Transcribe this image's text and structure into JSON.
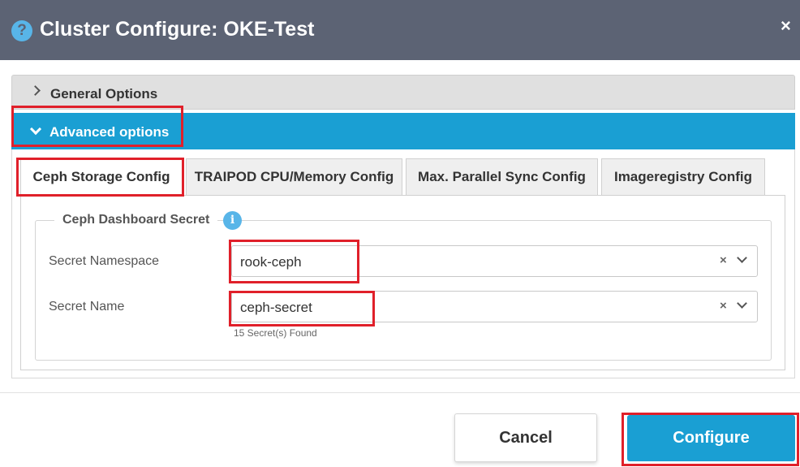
{
  "dialog": {
    "title": "Cluster Configure: OKE-Test",
    "help_glyph": "?",
    "close_glyph": "×"
  },
  "accordion": {
    "general_label": "General Options",
    "advanced_label": "Advanced options"
  },
  "tabs": [
    {
      "label": "Ceph Storage Config",
      "active": true
    },
    {
      "label": "TRAIPOD CPU/Memory Config",
      "active": false
    },
    {
      "label": "Max. Parallel Sync Config",
      "active": false
    },
    {
      "label": "Imageregistry Config",
      "active": false
    }
  ],
  "section": {
    "legend": "Ceph Dashboard Secret",
    "info_glyph": "i"
  },
  "fields": {
    "namespace_label": "Secret Namespace",
    "namespace_value": "rook-ceph",
    "name_label": "Secret Name",
    "name_value": "ceph-secret",
    "clear_glyph": "×",
    "name_hint": "15 Secret(s) Found"
  },
  "footer": {
    "cancel_label": "Cancel",
    "configure_label": "Configure"
  },
  "colors": {
    "titlebar": "#5c6374",
    "accent": "#1a9fd3",
    "highlight": "#e0202a"
  },
  "icons": {
    "help": "question-circle-icon",
    "close": "close-icon",
    "collapsed": "chevron-right-icon",
    "expanded": "chevron-down-icon",
    "info": "info-circle-icon",
    "clear": "clear-icon",
    "dropdown": "chevron-down-icon"
  }
}
